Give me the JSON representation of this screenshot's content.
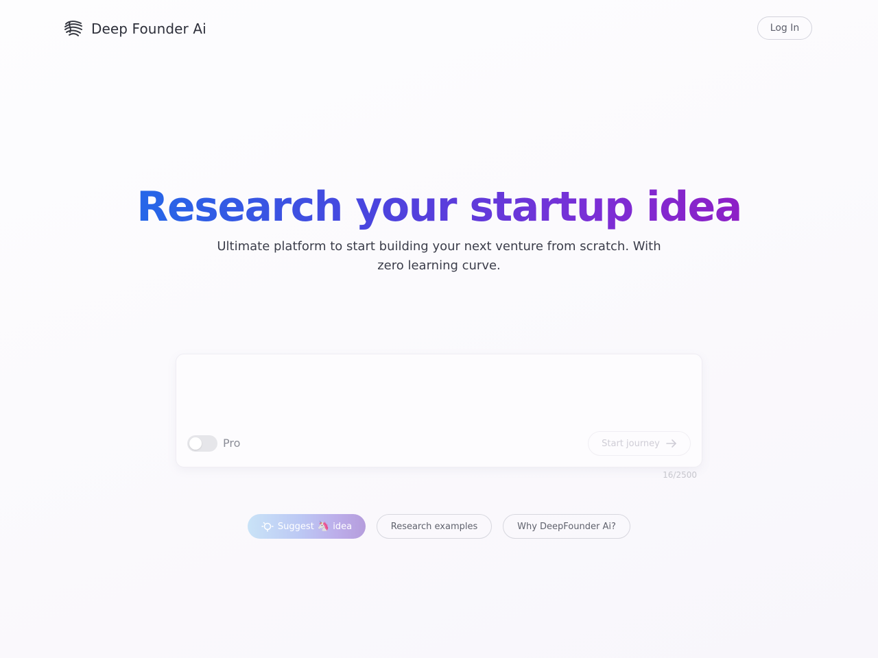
{
  "header": {
    "brand": "Deep Founder Ai",
    "logo_icon": "brain-lines-icon",
    "login_label": "Log In"
  },
  "hero": {
    "title": "Research your startup idea",
    "subtitle": "Ultimate platform to start building your next venture from scratch. With zero learning curve."
  },
  "idea_input": {
    "value": "",
    "placeholder": "",
    "pro_label": "Pro",
    "pro_enabled": false,
    "start_label": "Start journey",
    "start_icon": "arrow-right-icon",
    "char_count": "16/2500"
  },
  "actions": {
    "suggest": {
      "prefix": "Suggest",
      "emoji": "🦄",
      "suffix": "idea",
      "icon": "lightbulb-icon"
    },
    "examples_label": "Research examples",
    "why_label": "Why DeepFounder Ai?"
  },
  "colors": {
    "title_gradient_start": "#2567e8",
    "title_gradient_end": "#8d1fc6",
    "background": "#fbfafd"
  }
}
